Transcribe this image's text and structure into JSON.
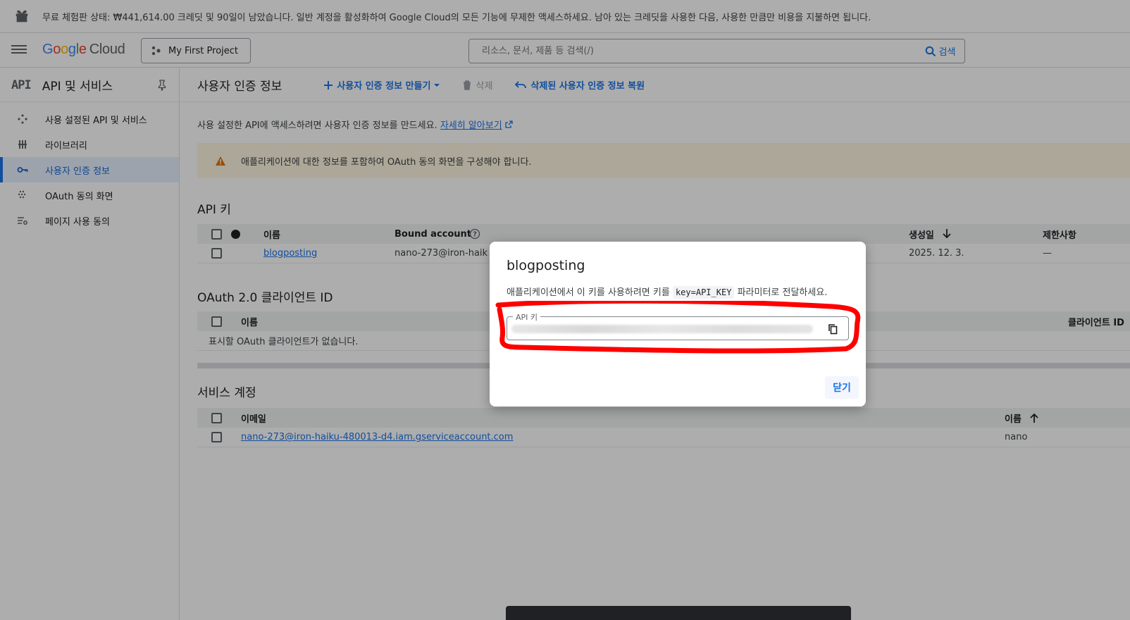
{
  "banner": {
    "message": "무료 체험판 상태: ₩441,614.00 크레딧 및 90일이 남았습니다. 일반 계정을 활성화하여 Google Cloud의 모든 기능에 무제한 액세스하세요. 남아 있는 크레딧을 사용한 다음, 사용한 만큼만 비용을 지불하면 됩니다."
  },
  "header": {
    "logo_google": [
      "G",
      "o",
      "o",
      "g",
      "l",
      "e"
    ],
    "logo_cloud": "Cloud",
    "project": "My First Project",
    "search_placeholder": "리소스, 문서, 제품 등 검색(/)",
    "search_button": "검색"
  },
  "sidebar": {
    "api_logo": "API",
    "title": "API 및 서비스",
    "items": [
      {
        "label": "사용 설정된 API 및 서비스",
        "icon": "apis-icon"
      },
      {
        "label": "라이브러리",
        "icon": "library-icon"
      },
      {
        "label": "사용자 인증 정보",
        "icon": "key-icon",
        "active": true
      },
      {
        "label": "OAuth 동의 화면",
        "icon": "oauth-icon"
      },
      {
        "label": "페이지 사용 동의",
        "icon": "settings-list-icon"
      }
    ]
  },
  "page": {
    "title": "사용자 인증 정보",
    "actions": {
      "create": "사용자 인증 정보 만들기",
      "delete": "삭제",
      "restore": "삭제된 사용자 인증 정보 복원"
    },
    "intro_text": "사용 설정한 API에 액세스하려면 사용자 인증 정보를 만드세요.",
    "intro_link": "자세히 알아보기",
    "warning": "애플리케이션에 대한 정보를 포함하여 OAuth 동의 화면을 구성해야 합니다."
  },
  "api_keys": {
    "title": "API 키",
    "columns": {
      "name": "이름",
      "bound": "Bound account",
      "created": "생성일",
      "restrictions": "제한사항"
    },
    "rows": [
      {
        "name": "blogposting",
        "bound": "nano-273@iron-haik",
        "created": "2025. 12. 3.",
        "restrictions": "—"
      }
    ]
  },
  "oauth": {
    "title": "OAuth 2.0 클라이언트 ID",
    "columns": {
      "name": "이름",
      "client_id": "클라이언트 ID"
    },
    "empty": "표시할 OAuth 클라이언트가 없습니다."
  },
  "service_accounts": {
    "title": "서비스 계정",
    "columns": {
      "email": "이메일",
      "name": "이름"
    },
    "rows": [
      {
        "email": "nano-273@iron-haiku-480013-d4.iam.gserviceaccount.com",
        "name": "nano"
      }
    ]
  },
  "dialog": {
    "title": "blogposting",
    "desc_before": "애플리케이션에서 이 키를 사용하려면 키를",
    "desc_code": "key=API_KEY",
    "desc_after": "파라미터로 전달하세요.",
    "field_label": "API 키",
    "close": "닫기"
  },
  "colors": {
    "accent": "#1a73e8",
    "highlight": "#ff0000",
    "warning": "#e37400"
  }
}
